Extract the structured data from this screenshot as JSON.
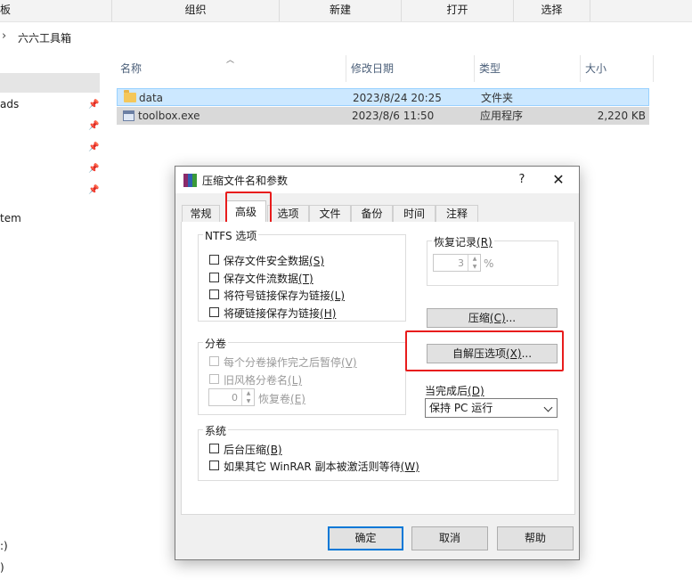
{
  "ribbon": {
    "tabs": [
      "",
      "组织",
      "新建",
      "打开",
      "选择"
    ],
    "partial_first": "板"
  },
  "address": {
    "crumb": "六六工具箱"
  },
  "nav": {
    "items": [
      {
        "label": "",
        "pinned": false
      },
      {
        "label": "ads",
        "pinned": true
      },
      {
        "label": "",
        "pinned": true
      },
      {
        "label": "",
        "pinned": true
      },
      {
        "label": "",
        "pinned": true
      },
      {
        "label": "",
        "pinned": true
      },
      {
        "label": "tem",
        "pinned": false
      }
    ],
    "bottom": [
      ":)",
      ")"
    ]
  },
  "list": {
    "headers": {
      "name": "名称",
      "date": "修改日期",
      "type": "类型",
      "size": "大小"
    },
    "rows": [
      {
        "name": "data",
        "date": "2023/8/24 20:25",
        "type": "文件夹",
        "size": "",
        "icon": "folder-icon"
      },
      {
        "name": "toolbox.exe",
        "date": "2023/8/6 11:50",
        "type": "应用程序",
        "size": "2,220 KB",
        "icon": "exe-icon"
      }
    ]
  },
  "dialog": {
    "title": "压缩文件名和参数",
    "help": "?",
    "close": "✕",
    "tabs": [
      "常规",
      "高级",
      "选项",
      "文件",
      "备份",
      "时间",
      "注释"
    ],
    "active_tab": "高级",
    "ntfs": {
      "label": "NTFS 选项",
      "items": [
        {
          "text": "保存文件安全数据",
          "key": "(S)"
        },
        {
          "text": "保存文件流数据",
          "key": "(T)"
        },
        {
          "text": "将符号链接保存为链接",
          "key": "(L)"
        },
        {
          "text": "将硬链接保存为链接",
          "key": "(H)"
        }
      ]
    },
    "volume": {
      "label": "分卷",
      "items": [
        {
          "text": "每个分卷操作完之后暂停",
          "key": "(V)"
        },
        {
          "text": "旧风格分卷名",
          "key": "(L)"
        }
      ],
      "recovery_volumes": {
        "value": "0",
        "text": "恢复卷",
        "key": "(E)"
      }
    },
    "recovery": {
      "label": "恢复记录",
      "key": "(R)",
      "value": "3",
      "unit": "%"
    },
    "compress_button": {
      "text": "压缩",
      "key": "(C)",
      "suffix": "..."
    },
    "sfx_button": {
      "text": "自解压选项",
      "key": "(X)",
      "suffix": "..."
    },
    "after": {
      "label": "当完成后",
      "key": "(D)",
      "value": "保持 PC 运行"
    },
    "system": {
      "label": "系统",
      "items": [
        {
          "text": "后台压缩",
          "key": "(B)"
        },
        {
          "text": "如果其它 WinRAR 副本被激活则等待",
          "key": "(W)"
        }
      ]
    },
    "buttons": {
      "ok": "确定",
      "cancel": "取消",
      "help": "帮助"
    }
  },
  "colors": {
    "highlight_red": "#e81c1c",
    "selection": "#cce8ff",
    "default_button": "#0078d7"
  }
}
